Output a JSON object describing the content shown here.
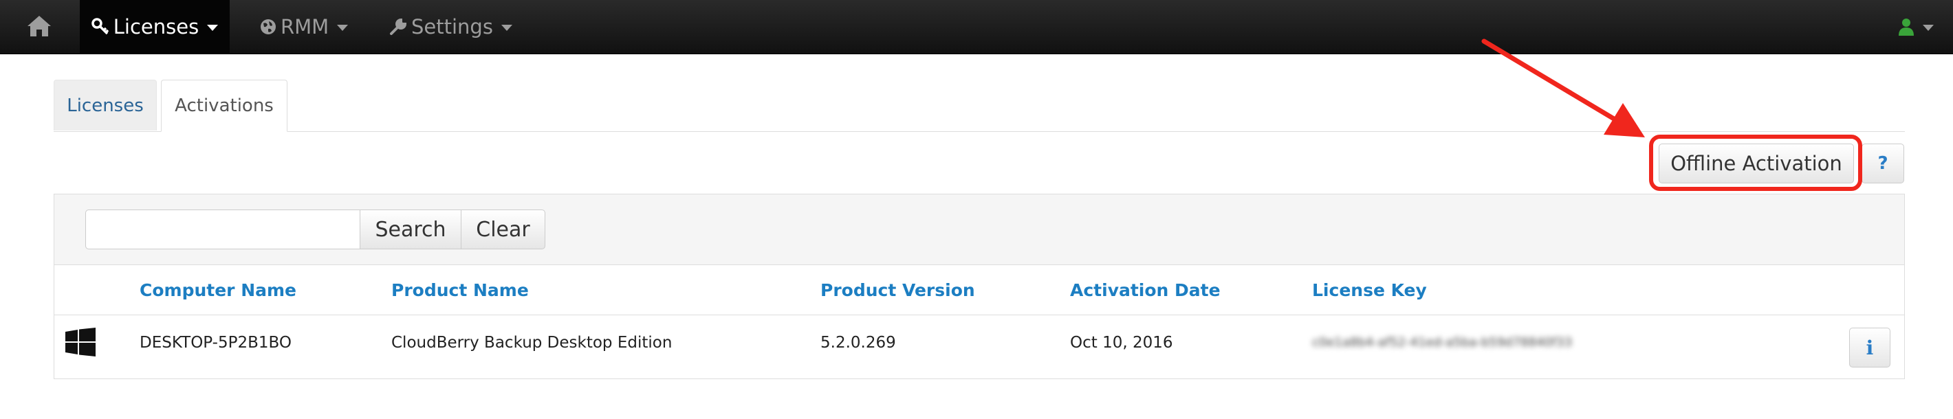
{
  "navbar": {
    "home_icon": "home-icon",
    "items": [
      {
        "label": "Licenses",
        "icon": "key-icon",
        "active": true
      },
      {
        "label": "RMM",
        "icon": "globe-icon",
        "active": false
      },
      {
        "label": "Settings",
        "icon": "wrench-icon",
        "active": false
      }
    ],
    "user_icon": "user-icon",
    "user_icon_color": "#3aa43a"
  },
  "tabs": [
    {
      "label": "Licenses",
      "active": false
    },
    {
      "label": "Activations",
      "active": true
    }
  ],
  "actions": {
    "offline_activation_label": "Offline Activation",
    "help_label": "?"
  },
  "search": {
    "value": "",
    "placeholder": "",
    "search_label": "Search",
    "clear_label": "Clear"
  },
  "table": {
    "columns": [
      "Computer Name",
      "Product Name",
      "Product Version",
      "Activation Date",
      "License Key"
    ],
    "rows": [
      {
        "os_icon": "windows-icon",
        "computer_name": "DESKTOP-5P2B1BO",
        "product_name": "CloudBerry Backup Desktop Edition",
        "product_version": "5.2.0.269",
        "activation_date": "Oct 10, 2016",
        "license_key": "c0e1a8b4-af52-41ed-a5ba-b59d78840f33",
        "info_label": "i"
      }
    ]
  },
  "annotation_color": "#f0261d"
}
